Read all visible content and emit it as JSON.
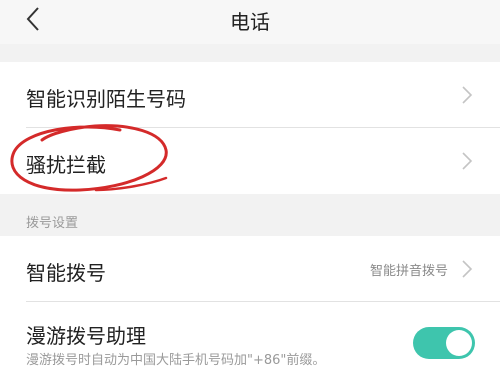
{
  "header": {
    "title": "电话",
    "back_icon": "chevron-left-icon"
  },
  "settings": {
    "items": [
      {
        "label": "智能识别陌生号码"
      },
      {
        "label": "骚扰拦截"
      }
    ]
  },
  "dial_section": {
    "header": "拨号设置",
    "smart_dial": {
      "label": "智能拨号",
      "value": "智能拼音拨号"
    },
    "roaming_assist": {
      "label": "漫游拨号助理",
      "description": "漫游拨号时自动为中国大陆手机号码加\"+86\"前缀。",
      "enabled": true
    }
  },
  "colors": {
    "accent": "#3ec5ad",
    "annotation": "#d42a2a"
  }
}
